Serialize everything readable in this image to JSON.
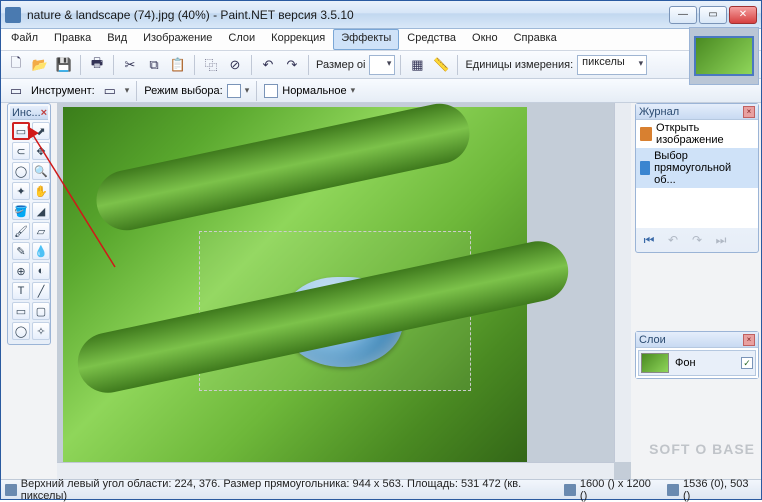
{
  "title": "nature & landscape (74).jpg (40%) - Paint.NET версия 3.5.10",
  "menu": {
    "items": [
      "Файл",
      "Правка",
      "Вид",
      "Изображение",
      "Слои",
      "Коррекция",
      "Эффекты",
      "Средства",
      "Окно",
      "Справка"
    ],
    "active_index": 6
  },
  "toolbar": {
    "size_label": "Размер оі",
    "units_label": "Единицы измерения:",
    "units_value": "пикселы"
  },
  "toolbar2": {
    "instrument_label": "Инструмент:",
    "mode_label": "Режим выбора:",
    "normal_label": "Нормальное"
  },
  "toolbox": {
    "title": "Инс..."
  },
  "history": {
    "title": "Журнал",
    "items": [
      "Открыть изображение",
      "Выбор прямоугольной об..."
    ],
    "selected_index": 1
  },
  "layers": {
    "title": "Слои",
    "items": [
      {
        "name": "Фон",
        "visible": true
      }
    ]
  },
  "status": {
    "left": "Верхний левый угол области: 224, 376. Размер прямоугольника: 944 x 563. Площадь: 531 472 (кв. пикселы)",
    "dims": "1600 () x 1200 ()",
    "cursor": "1536 (0), 503 ()"
  },
  "watermark": "SOFT O BASE"
}
